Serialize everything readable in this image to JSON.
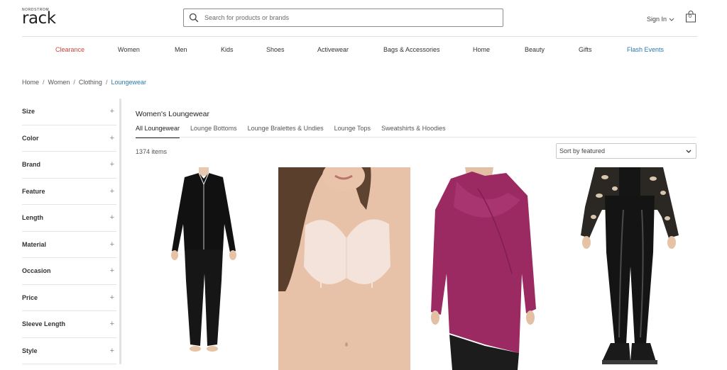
{
  "header": {
    "logo_small": "NORDSTROM",
    "logo_big": "rack",
    "search_placeholder": "Search for products or brands",
    "signin_label": "Sign In",
    "bag_count": "0"
  },
  "nav": {
    "items": [
      "Clearance",
      "Women",
      "Men",
      "Kids",
      "Shoes",
      "Activewear",
      "Bags & Accessories",
      "Home",
      "Beauty",
      "Gifts",
      "Flash Events"
    ]
  },
  "breadcrumb": [
    "Home",
    "Women",
    "Clothing",
    "Loungewear"
  ],
  "sidebar": {
    "filters": [
      "Size",
      "Color",
      "Brand",
      "Feature",
      "Length",
      "Material",
      "Occasion",
      "Price",
      "Sleeve Length",
      "Style"
    ]
  },
  "main": {
    "heading": "Women's Loungewear",
    "tabs": [
      "All Loungewear",
      "Lounge Bottoms",
      "Lounge Bralettes & Undies",
      "Lounge Tops",
      "Sweatshirts & Hoodies"
    ],
    "item_count": "1374 items",
    "sort_label": "Sort by featured"
  },
  "colors": {
    "clearance": "#d0463a",
    "flash_events": "#2a7ab0",
    "breadcrumb_current": "#2a7ab0"
  },
  "icons": {
    "search": "search-icon",
    "bag": "shopping-bag-icon",
    "chevron": "chevron-down-icon",
    "plus": "plus-icon"
  }
}
